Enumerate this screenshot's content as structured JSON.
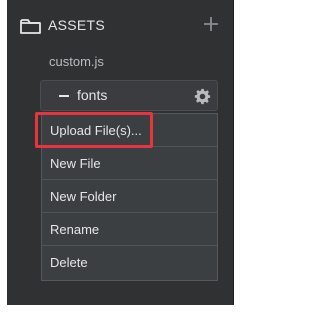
{
  "assets": {
    "title": "ASSETS",
    "folder_icon": "folder-icon",
    "add_icon": "plus-icon"
  },
  "files": [
    {
      "name": "custom.js"
    }
  ],
  "folder": {
    "label": "fonts",
    "toggle_icon": "minus-icon",
    "settings_icon": "gear-icon"
  },
  "context_menu": {
    "items": [
      {
        "label": "Upload File(s)..."
      },
      {
        "label": "New File"
      },
      {
        "label": "New Folder"
      },
      {
        "label": "Rename"
      },
      {
        "label": "Delete"
      }
    ]
  },
  "colors": {
    "panel": "#2f3133",
    "menu": "#3c3f42",
    "highlight": "#e8343f"
  }
}
